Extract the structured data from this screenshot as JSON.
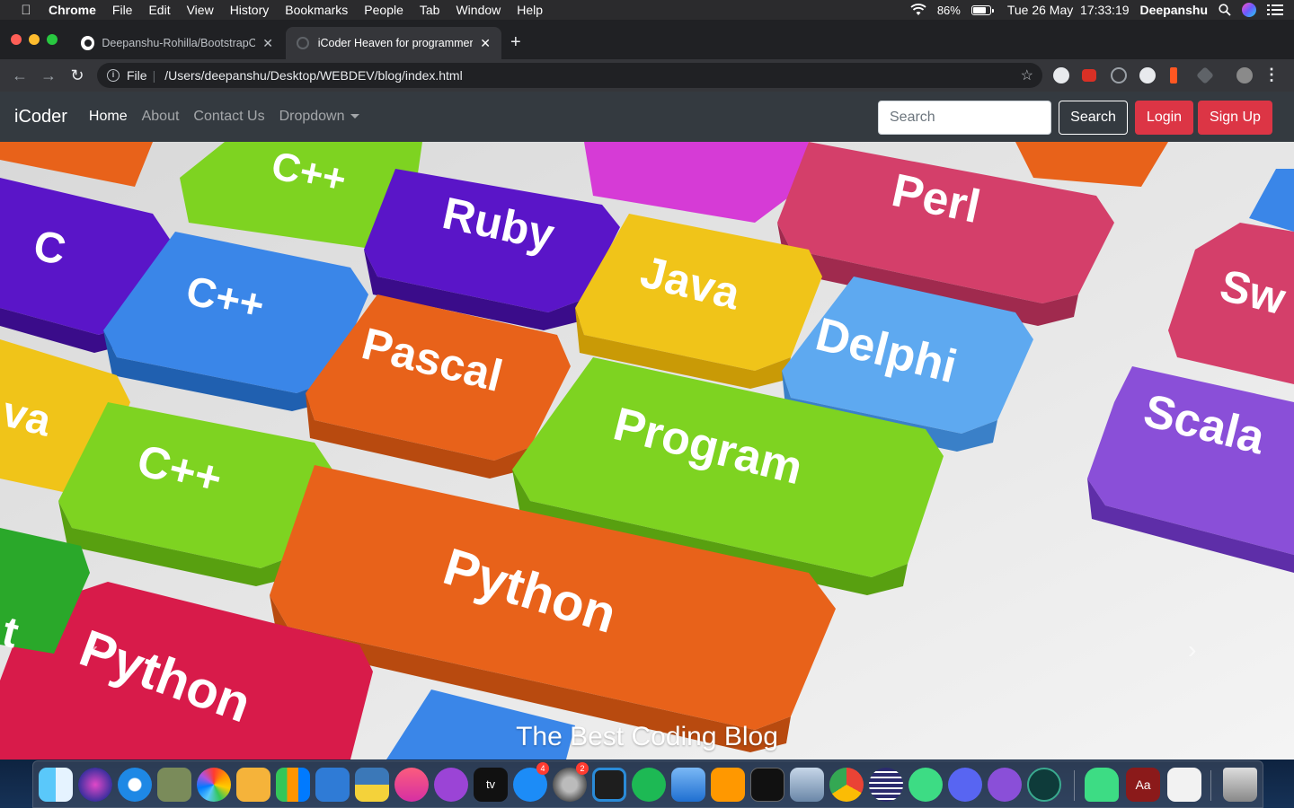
{
  "menubar": {
    "app": "Chrome",
    "items": [
      "File",
      "Edit",
      "View",
      "History",
      "Bookmarks",
      "People",
      "Tab",
      "Window",
      "Help"
    ],
    "battery_percent": "86%",
    "battery_level": 0.86,
    "datetime": "Tue 26 May  17:33:19",
    "user": "Deepanshu"
  },
  "browser": {
    "tabs": [
      {
        "title": "Deepanshu-Rohilla/BootstrapC",
        "icon": "github-icon",
        "active": false
      },
      {
        "title": "iCoder Heaven for programmer",
        "icon": "globe-icon",
        "active": true
      }
    ],
    "omnibox": {
      "scheme": "File",
      "url": "/Users/deepanshu/Desktop/WEBDEV/blog/index.html"
    }
  },
  "site": {
    "brand": "iCoder",
    "nav": [
      {
        "label": "Home",
        "active": true
      },
      {
        "label": "About",
        "active": false
      },
      {
        "label": "Contact Us",
        "active": false
      },
      {
        "label": "Dropdown",
        "active": false
      }
    ],
    "search_placeholder": "Search",
    "search_button": "Search",
    "login_button": "Login",
    "signup_button": "Sign Up"
  },
  "carousel": {
    "caption": "The Best Coding Blog",
    "prev_icon": "‹",
    "next_icon": "›",
    "keys": [
      "C",
      "C++",
      "Ruby",
      "Perl",
      "C++",
      "Java",
      "Delphi",
      "Sw",
      "Pascal",
      "Program",
      "Scala",
      "C++",
      "Python",
      "Python",
      "va",
      "t"
    ]
  },
  "dock": {
    "badges": {
      "app_store": "4",
      "system_preferences": "2"
    }
  },
  "colors": {
    "navbar_bg": "#343a40",
    "danger": "#dc3545"
  }
}
